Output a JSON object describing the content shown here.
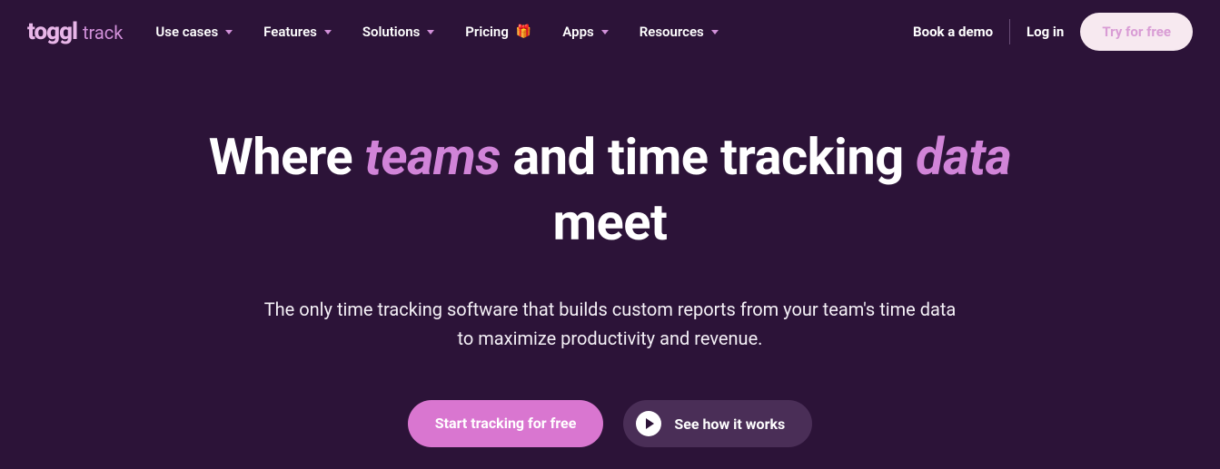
{
  "logo": {
    "brand": "toggl",
    "product": "track"
  },
  "nav": {
    "use_cases": "Use cases",
    "features": "Features",
    "solutions": "Solutions",
    "pricing": "Pricing",
    "apps": "Apps",
    "resources": "Resources"
  },
  "actions": {
    "demo": "Book a demo",
    "login": "Log in",
    "try": "Try for free"
  },
  "hero": {
    "t1": "Where ",
    "t2": "teams",
    "t3": " and time tracking ",
    "t4": "data",
    "t5": " meet",
    "sub": "The only time tracking software that builds custom reports from your team's time data to maximize productivity and revenue."
  },
  "cta": {
    "primary": "Start tracking for free",
    "secondary": "See how it works"
  }
}
